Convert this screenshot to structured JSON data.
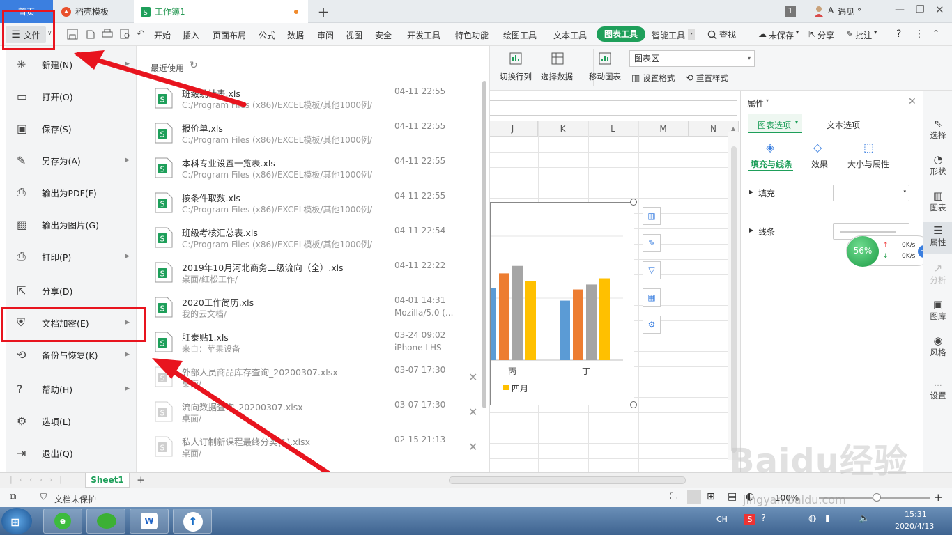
{
  "tabs": {
    "home": "首页",
    "daoke": "稻壳模板",
    "workbook": "工作簿1",
    "add": "+"
  },
  "titlebar_right": {
    "badge": "1",
    "user_letter": "A",
    "user": "遇见 °"
  },
  "menu": {
    "file": "文件",
    "items": [
      "开始",
      "插入",
      "页面布局",
      "公式",
      "数据",
      "审阅",
      "视图",
      "安全",
      "开发工具",
      "特色功能",
      "绘图工具",
      "文本工具"
    ],
    "chart_tools": "图表工具",
    "smart_tools": "智能工具",
    "search": "查找",
    "unsaved": "未保存",
    "share": "分享",
    "comment": "批注"
  },
  "ribbon": {
    "switch_rowcol": "切换行列",
    "select_data": "选择数据",
    "move_chart": "移动图表",
    "chart_area": "图表区",
    "set_format": "设置格式",
    "reset_style": "重置样式"
  },
  "columns": [
    "J",
    "K",
    "L",
    "M",
    "N"
  ],
  "chart_data": {
    "type": "bar",
    "categories": [
      "丙",
      "丁"
    ],
    "series": [
      {
        "name": "",
        "values": [
          58,
          48
        ]
      },
      {
        "name": "",
        "values": [
          70,
          57
        ]
      },
      {
        "name": "",
        "values": [
          76,
          61
        ]
      },
      {
        "name": "",
        "values": [
          64,
          66
        ]
      },
      {
        "name": "四月",
        "values": [
          null,
          null
        ]
      }
    ],
    "colors": [
      "#5b9bd5",
      "#ed7d31",
      "#a5a5a5",
      "#ffc000"
    ],
    "legend_visible": "四月",
    "ylim": [
      0,
      100
    ]
  },
  "props": {
    "title": "属性",
    "tab_chart": "图表选项",
    "tab_text": "文本选项",
    "sub_fill_line": "填充与线条",
    "sub_effect": "效果",
    "sub_size": "大小与属性",
    "fill": "填充",
    "line": "线条"
  },
  "sidebar": [
    "选择",
    "形状",
    "图表",
    "属性",
    "分析",
    "图库",
    "风格",
    "设置"
  ],
  "net_widget": {
    "percent": "56%",
    "up": "0K/s",
    "down": "0K/s"
  },
  "file_menu": {
    "items": [
      {
        "label": "新建(N)",
        "arrow": true
      },
      {
        "label": "打开(O)",
        "arrow": false
      },
      {
        "label": "保存(S)",
        "arrow": false
      },
      {
        "label": "另存为(A)",
        "arrow": true
      },
      {
        "label": "输出为PDF(F)",
        "arrow": false
      },
      {
        "label": "输出为图片(G)",
        "arrow": false
      },
      {
        "label": "打印(P)",
        "arrow": true
      },
      {
        "label": "分享(D)",
        "arrow": false
      },
      {
        "label": "文档加密(E)",
        "arrow": true
      },
      {
        "label": "备份与恢复(K)",
        "arrow": true
      },
      {
        "label": "帮助(H)",
        "arrow": true
      },
      {
        "label": "选项(L)",
        "arrow": false
      },
      {
        "label": "退出(Q)",
        "arrow": false
      }
    ]
  },
  "recent": {
    "header": "最近使用",
    "files": [
      {
        "name": "班级统计表.xls",
        "path": "C:/Program Files (x86)/EXCEL模板/其他1000例/",
        "date": "04-11 22:55",
        "extra": ""
      },
      {
        "name": "报价单.xls",
        "path": "C:/Program Files (x86)/EXCEL模板/其他1000例/",
        "date": "04-11 22:55",
        "extra": ""
      },
      {
        "name": "本科专业设置一览表.xls",
        "path": "C:/Program Files (x86)/EXCEL模板/其他1000例/",
        "date": "04-11 22:55",
        "extra": ""
      },
      {
        "name": "按条件取数.xls",
        "path": "C:/Program Files (x86)/EXCEL模板/其他1000例/",
        "date": "04-11 22:55",
        "extra": ""
      },
      {
        "name": "班级考核汇总表.xls",
        "path": "C:/Program Files (x86)/EXCEL模板/其他1000例/",
        "date": "04-11 22:54",
        "extra": ""
      },
      {
        "name": "2019年10月河北商务二级流向（全）.xls",
        "path": "桌面/红松工作/",
        "date": "04-11 22:22",
        "extra": ""
      },
      {
        "name": "2020工作简历.xls",
        "path": "我的云文档/",
        "date": "04-01 14:31",
        "extra": "Mozilla/5.0 (..."
      },
      {
        "name": "肛泰贴1.xls",
        "path": "来自：苹果设备",
        "date": "03-24 09:02",
        "extra": "iPhone LHS"
      },
      {
        "name": "外部人员商品库存查询_20200307.xlsx",
        "path": "桌面/",
        "date": "03-07 17:30",
        "extra": ""
      },
      {
        "name": "流向数据查询_20200307.xlsx",
        "path": "桌面/",
        "date": "03-07 17:30",
        "extra": ""
      },
      {
        "name": "私人订制新课程最终分类(1).xlsx",
        "path": "桌面/",
        "date": "02-15 21:13",
        "extra": ""
      }
    ]
  },
  "sheet_tab": "Sheet1",
  "status": {
    "protect": "文档未保护",
    "zoom": "100%"
  },
  "tray": {
    "lang": "CH",
    "time": "15:31",
    "date": "2020/4/13"
  },
  "watermark": {
    "brand": "Baidu经验",
    "url": "jingyan.baidu.com"
  }
}
